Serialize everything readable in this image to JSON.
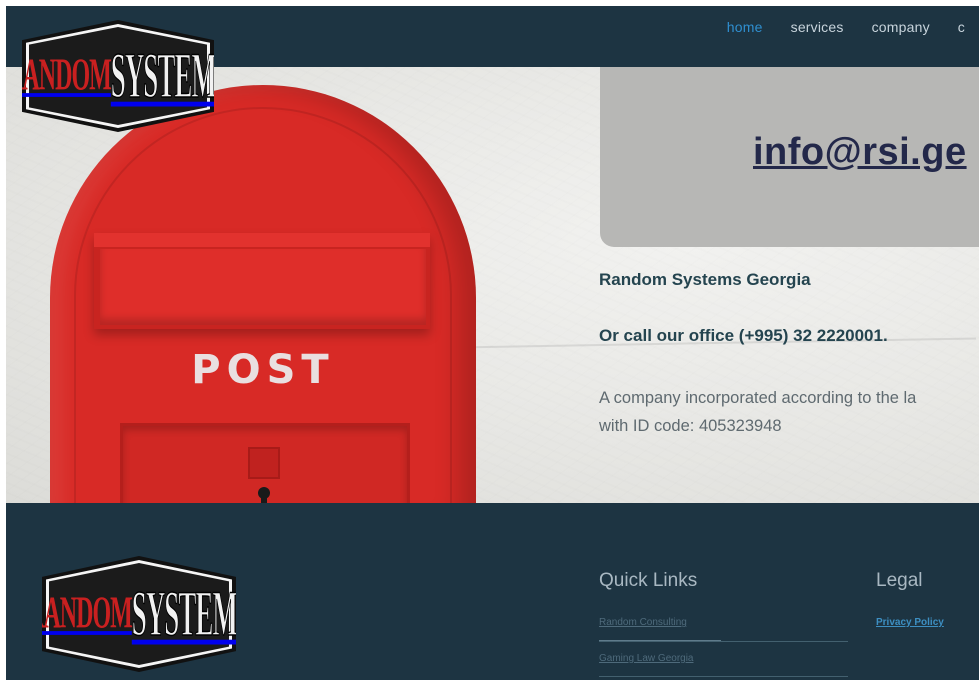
{
  "header": {
    "logo": {
      "left_text": "RANDOM",
      "right_text": "SYSTEMS"
    },
    "nav": [
      {
        "label": "home",
        "active": true
      },
      {
        "label": "services",
        "active": false
      },
      {
        "label": "company",
        "active": false
      },
      {
        "label": "c",
        "active": false
      }
    ]
  },
  "hero": {
    "mailbox_label": "POST",
    "contact_email": "info@rsi.ge",
    "company_name": "Random Systems Georgia",
    "call_line": "Or call our office (+995) 32 2220001.",
    "legal_line_1": "A company incorporated according to the la",
    "legal_line_2": "with ID code: 405323948"
  },
  "footer": {
    "logo": {
      "left_text": "RANDOM",
      "right_text": "SYSTEMS"
    },
    "quick_links_title": "Quick Links",
    "quick_links": [
      "Random Consulting",
      "Gaming Law Georgia"
    ],
    "legal_title": "Legal",
    "legal_links": [
      "Privacy Policy"
    ]
  },
  "colors": {
    "header_bg": "#1d3442",
    "nav_active": "#2f8fd0",
    "mailbox_red": "#d82a26",
    "contact_box": "#b7b7b5",
    "email_text": "#23284a",
    "body_text": "#24444f",
    "privacy_link": "#3d8fc2"
  }
}
